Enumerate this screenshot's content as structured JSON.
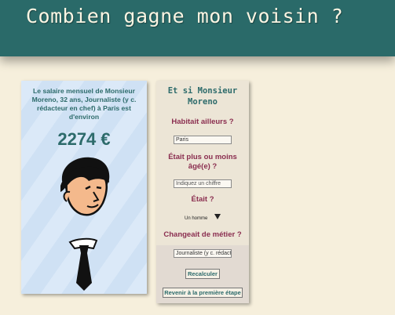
{
  "header": {
    "title": "Combien gagne mon voisin ?"
  },
  "result": {
    "description": "Le salaire mensuel de Monsieur Moreno, 32 ans, Journaliste (y c. rédacteur en chef) à Paris est d'environ",
    "amount": "2274 €"
  },
  "form": {
    "title": "Et si Monsieur Moreno",
    "q_location": "Habitait ailleurs ?",
    "location_value": "Paris",
    "q_age": "Était plus ou moins âgé(e) ?",
    "age_placeholder": "Indiquez un chiffre",
    "q_gender": "Était ?",
    "gender_value": "Un homme",
    "q_job": "Changeait de métier ?",
    "job_value": "Journaliste (y c. rédact",
    "recalc_label": "Recalculer",
    "back_label": "Revenir à la première étape"
  },
  "colors": {
    "header_bg": "#2a6a69",
    "accent_teal": "#2d6b6b",
    "question_maroon": "#8a2d4f",
    "page_bg": "#f6efdc"
  }
}
